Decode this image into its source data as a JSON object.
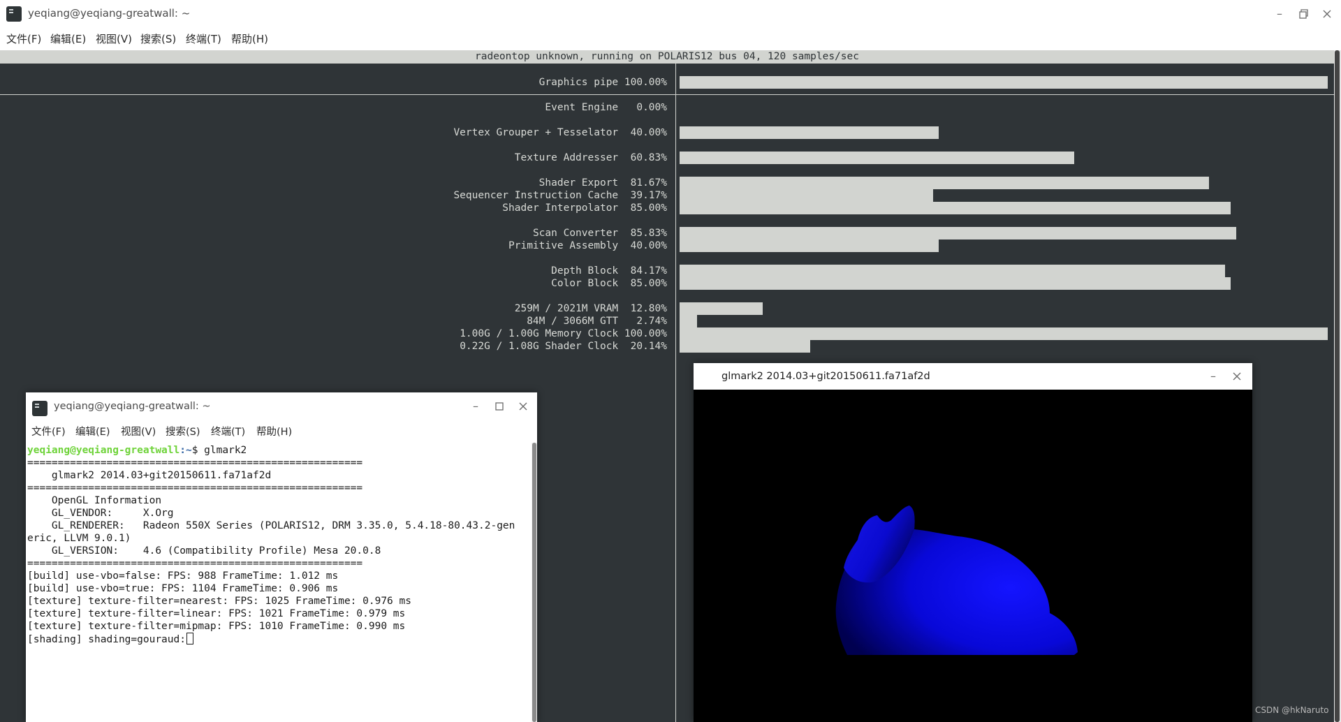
{
  "main_window": {
    "title": "yeqiang@yeqiang-greatwall: ~",
    "menu": [
      "文件(F)",
      "编辑(E)",
      "视图(V)",
      "搜索(S)",
      "终端(T)",
      "帮助(H)"
    ]
  },
  "radeontop": {
    "header": "radeontop unknown, running on POLARIS12 bus 04, 120 samples/sec",
    "rows": [
      {
        "label": "Graphics pipe 100.00%",
        "value": 100.0
      },
      {
        "label": "Event Engine   0.00%",
        "value": 0.0
      },
      {
        "label": "Vertex Grouper + Tesselator  40.00%",
        "value": 40.0
      },
      {
        "label": "Texture Addresser  60.83%",
        "value": 60.83
      },
      {
        "label": "Shader Export  81.67%",
        "value": 81.67
      },
      {
        "label": "Sequencer Instruction Cache  39.17%",
        "value": 39.17
      },
      {
        "label": "Shader Interpolator  85.00%",
        "value": 85.0
      },
      {
        "label": "Scan Converter  85.83%",
        "value": 85.83
      },
      {
        "label": "Primitive Assembly  40.00%",
        "value": 40.0
      },
      {
        "label": "Depth Block  84.17%",
        "value": 84.17
      },
      {
        "label": "Color Block  85.00%",
        "value": 85.0
      },
      {
        "label": "259M / 2021M VRAM  12.80%",
        "value": 12.8
      },
      {
        "label": "84M / 3066M GTT   2.74%",
        "value": 2.74
      },
      {
        "label": "1.00G / 1.00G Memory Clock 100.00%",
        "value": 100.0
      },
      {
        "label": "0.22G / 1.08G Shader Clock  20.14%",
        "value": 20.14
      }
    ]
  },
  "terminal2": {
    "title": "yeqiang@yeqiang-greatwall: ~",
    "menu": [
      "文件(F)",
      "编辑(E)",
      "视图(V)",
      "搜索(S)",
      "终端(T)",
      "帮助(H)"
    ],
    "prompt_user": "yeqiang@yeqiang-greatwall",
    "prompt_path": ":~",
    "prompt_cmd": "$ glmark2",
    "lines": [
      "=======================================================",
      "    glmark2 2014.03+git20150611.fa71af2d",
      "=======================================================",
      "    OpenGL Information",
      "    GL_VENDOR:     X.Org",
      "    GL_RENDERER:   Radeon 550X Series (POLARIS12, DRM 3.35.0, 5.4.18-80.43.2-gen",
      "eric, LLVM 9.0.1)",
      "    GL_VERSION:    4.6 (Compatibility Profile) Mesa 20.0.8",
      "=======================================================",
      "[build] use-vbo=false: FPS: 988 FrameTime: 1.012 ms",
      "[build] use-vbo=true: FPS: 1104 FrameTime: 0.906 ms",
      "[texture] texture-filter=nearest: FPS: 1025 FrameTime: 0.976 ms",
      "[texture] texture-filter=linear: FPS: 1021 FrameTime: 0.979 ms",
      "[texture] texture-filter=mipmap: FPS: 1010 FrameTime: 0.990 ms"
    ],
    "last_line": "[shading] shading=gouraud:"
  },
  "glmark_window": {
    "title": "glmark2 2014.03+git20150611.fa71af2d"
  },
  "watermark": "CSDN @hkNaruto"
}
